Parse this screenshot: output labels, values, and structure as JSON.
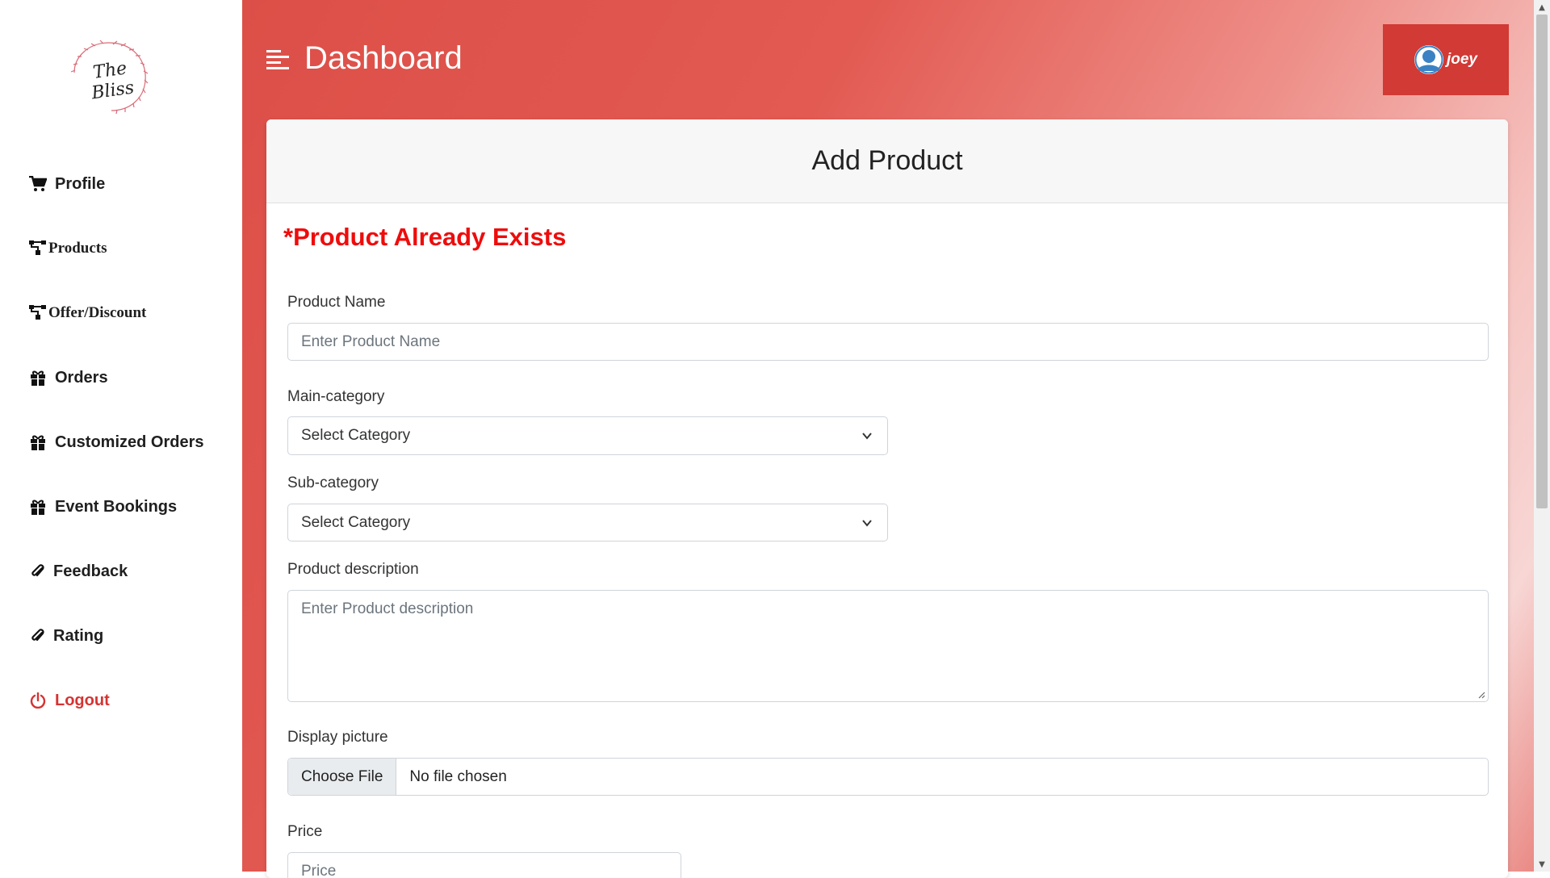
{
  "sidebar": {
    "logo_text": "The Bliss",
    "items": [
      {
        "label": "Profile",
        "icon": "cart-icon"
      },
      {
        "label": "Products",
        "icon": "sitemap-icon"
      },
      {
        "label": "Offer/Discount",
        "icon": "sitemap-icon"
      },
      {
        "label": "Orders",
        "icon": "gift-icon"
      },
      {
        "label": "Customized Orders",
        "icon": "gift-icon"
      },
      {
        "label": "Event Bookings",
        "icon": "gift-icon"
      },
      {
        "label": "Feedback",
        "icon": "paperclip-icon"
      },
      {
        "label": "Rating",
        "icon": "paperclip-icon"
      },
      {
        "label": "Logout",
        "icon": "power-icon"
      }
    ]
  },
  "header": {
    "title": "Dashboard",
    "user_name": "joey"
  },
  "form": {
    "title": "Add Product",
    "error": "*Product Already Exists",
    "product_name_label": "Product Name",
    "product_name_placeholder": "Enter Product Name",
    "main_category_label": "Main-category",
    "main_category_value": "Select Category",
    "sub_category_label": "Sub-category",
    "sub_category_value": "Select Category",
    "description_label": "Product description",
    "description_placeholder": "Enter Product description",
    "picture_label": "Display picture",
    "choose_file_label": "Choose File",
    "file_status": "No file chosen",
    "price_label": "Price",
    "price_placeholder": "Price"
  },
  "colors": {
    "accent": "#dc4f48",
    "user_button": "#d13a35",
    "error": "#ee0c0c",
    "logout": "#d63333"
  }
}
